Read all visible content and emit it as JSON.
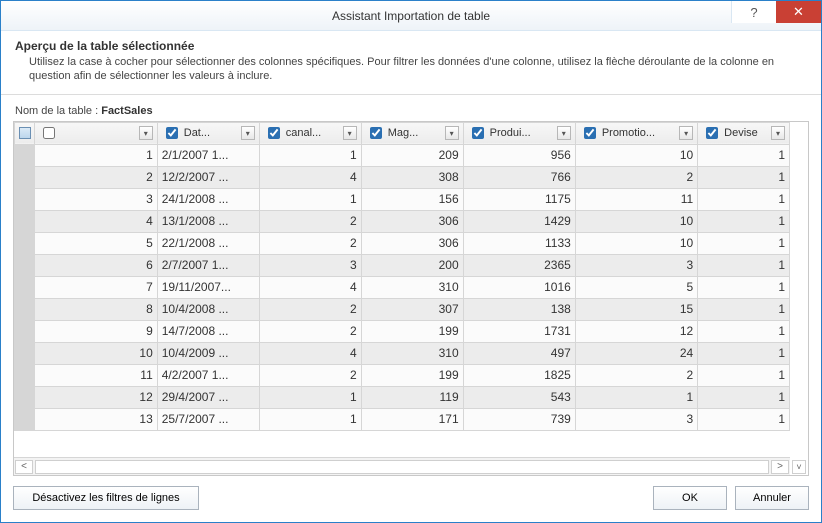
{
  "window": {
    "title": "Assistant Importation de table",
    "help_symbol": "?",
    "close_symbol": "✕"
  },
  "header": {
    "title": "Aperçu de la table sélectionnée",
    "description": "Utilisez la case à cocher pour sélectionner des colonnes spécifiques. Pour filtrer les données d'une colonne, utilisez la flèche déroulante de la colonne en question afin de sélectionner les valeurs à inclure."
  },
  "table_label": "Nom de la table :",
  "table_name": "FactSales",
  "columns": [
    {
      "label": "",
      "checkbox": false
    },
    {
      "label": "Dat...",
      "checkbox": true
    },
    {
      "label": "canal...",
      "checkbox": true
    },
    {
      "label": "Mag...",
      "checkbox": true
    },
    {
      "label": "Produi...",
      "checkbox": true
    },
    {
      "label": "Promotio...",
      "checkbox": true
    },
    {
      "label": "Devise",
      "checkbox": true
    }
  ],
  "rows": [
    {
      "n": "1",
      "date": "2/1/2007 1...",
      "canal": "1",
      "mag": "209",
      "prod": "956",
      "promo": "10",
      "devise": "1"
    },
    {
      "n": "2",
      "date": "12/2/2007 ...",
      "canal": "4",
      "mag": "308",
      "prod": "766",
      "promo": "2",
      "devise": "1"
    },
    {
      "n": "3",
      "date": "24/1/2008 ...",
      "canal": "1",
      "mag": "156",
      "prod": "1175",
      "promo": "11",
      "devise": "1"
    },
    {
      "n": "4",
      "date": "13/1/2008 ...",
      "canal": "2",
      "mag": "306",
      "prod": "1429",
      "promo": "10",
      "devise": "1"
    },
    {
      "n": "5",
      "date": "22/1/2008 ...",
      "canal": "2",
      "mag": "306",
      "prod": "1133",
      "promo": "10",
      "devise": "1"
    },
    {
      "n": "6",
      "date": "2/7/2007 1...",
      "canal": "3",
      "mag": "200",
      "prod": "2365",
      "promo": "3",
      "devise": "1"
    },
    {
      "n": "7",
      "date": "19/11/2007...",
      "canal": "4",
      "mag": "310",
      "prod": "1016",
      "promo": "5",
      "devise": "1"
    },
    {
      "n": "8",
      "date": "10/4/2008 ...",
      "canal": "2",
      "mag": "307",
      "prod": "138",
      "promo": "15",
      "devise": "1"
    },
    {
      "n": "9",
      "date": "14/7/2008 ...",
      "canal": "2",
      "mag": "199",
      "prod": "1731",
      "promo": "12",
      "devise": "1"
    },
    {
      "n": "10",
      "date": "10/4/2009 ...",
      "canal": "4",
      "mag": "310",
      "prod": "497",
      "promo": "24",
      "devise": "1"
    },
    {
      "n": "11",
      "date": "4/2/2007 1...",
      "canal": "2",
      "mag": "199",
      "prod": "1825",
      "promo": "2",
      "devise": "1"
    },
    {
      "n": "12",
      "date": "29/4/2007 ...",
      "canal": "1",
      "mag": "119",
      "prod": "543",
      "promo": "1",
      "devise": "1"
    },
    {
      "n": "13",
      "date": "25/7/2007 ...",
      "canal": "1",
      "mag": "171",
      "prod": "739",
      "promo": "3",
      "devise": "1"
    }
  ],
  "footer": {
    "clear_filters": "Désactivez les filtres de lignes",
    "ok": "OK",
    "cancel": "Annuler"
  },
  "dropdown_glyph": "▾",
  "scroll_left_glyph": "<",
  "scroll_right_glyph": ">",
  "scroll_down_glyph": "˅"
}
